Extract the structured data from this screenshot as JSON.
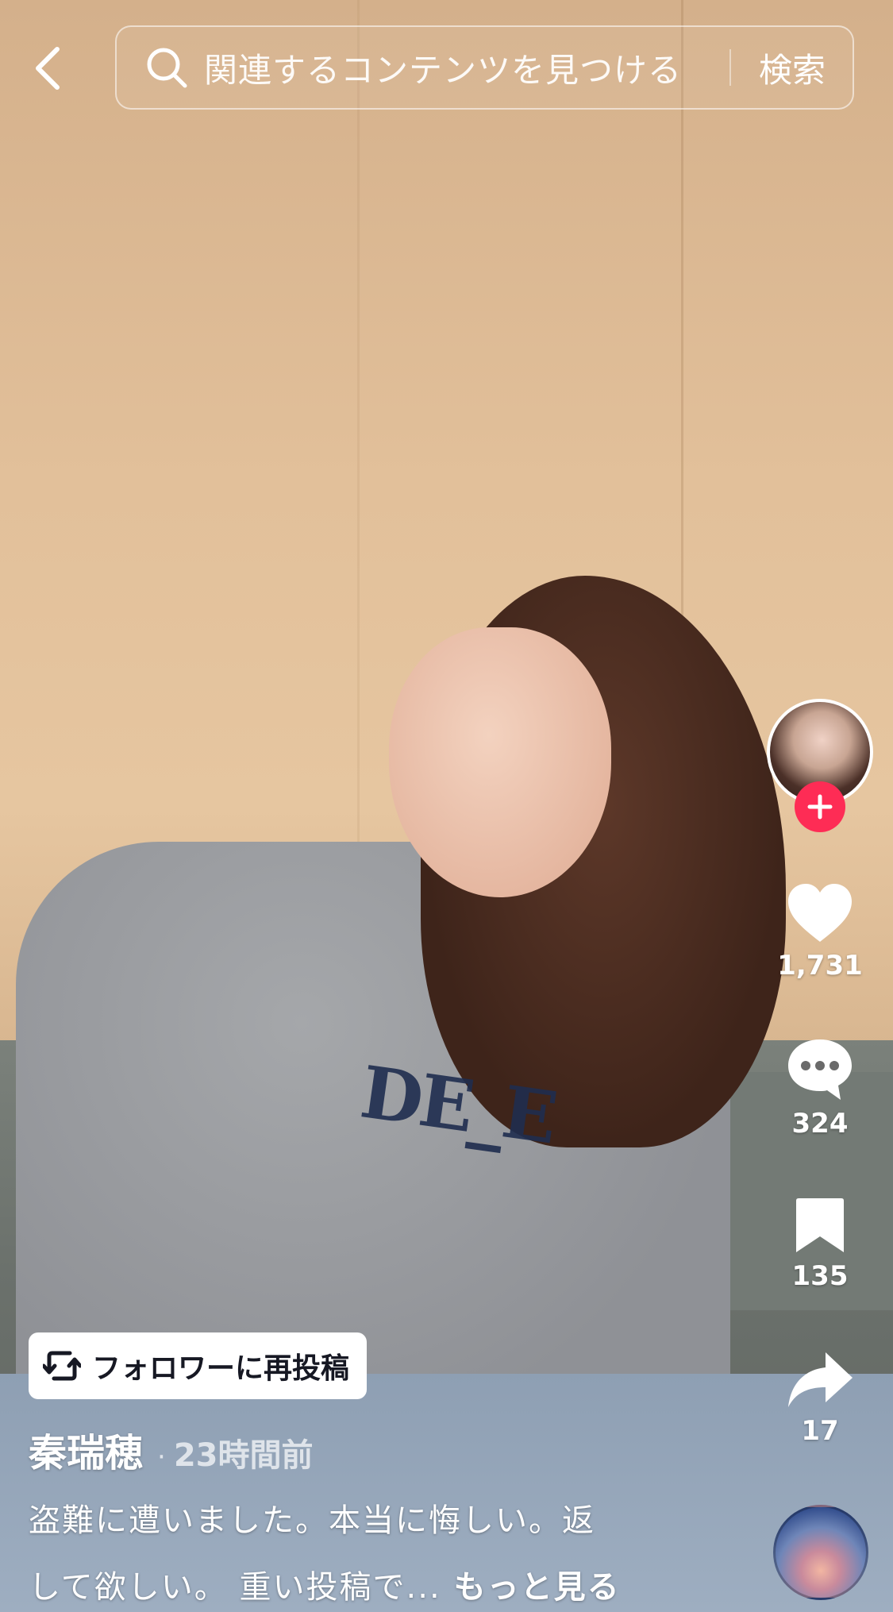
{
  "search": {
    "placeholder": "関連するコンテンツを見つける",
    "button_label": "検索"
  },
  "actions": {
    "likes": "1,731",
    "comments": "324",
    "saves": "135",
    "shares": "17"
  },
  "repost": {
    "label": "フォロワーに再投稿"
  },
  "post": {
    "author": "秦瑞穂",
    "separator": "·",
    "time": "23時間前",
    "caption_line1": "盗難に遭いました。本当に悔しい。返",
    "caption_line2": "して欲しい。 重い投稿で...",
    "see_more": "もっと見る"
  },
  "colors": {
    "follow_accent": "#fe2c55",
    "repost_chip_bg": "#ffffff",
    "repost_text": "#161823"
  },
  "icons": {
    "back": "chevron-left-icon",
    "search": "search-icon",
    "follow": "plus-icon",
    "like": "heart-icon",
    "comment": "comment-bubble-icon",
    "save": "bookmark-icon",
    "share": "share-arrow-icon",
    "repost": "repost-icon"
  }
}
